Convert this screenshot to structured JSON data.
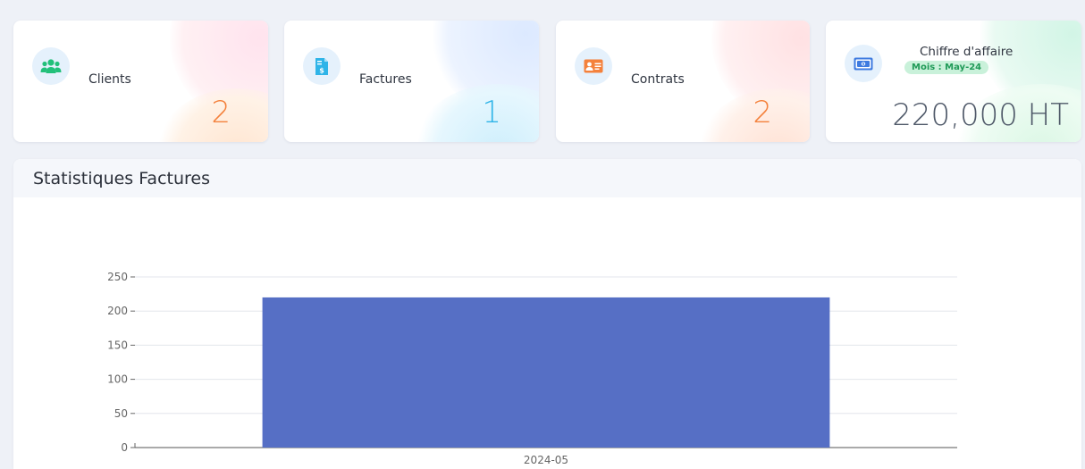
{
  "cards": {
    "clients": {
      "label": "Clients",
      "value": "2",
      "color": "#f4813c",
      "icon": "users-icon",
      "icon_color": "#22c07a"
    },
    "factures": {
      "label": "Factures",
      "value": "1",
      "color": "#2fb4e8",
      "icon": "invoice-dollar-icon",
      "icon_color": "#2fb4e8"
    },
    "contrats": {
      "label": "Contrats",
      "value": "2",
      "color": "#f4813c",
      "icon": "id-card-icon",
      "icon_color": "#f4813c"
    },
    "chiffre": {
      "label": "Chiffre d'affaire",
      "badge": "Mois : May-24",
      "value": "220,000 HT",
      "icon": "money-bill-icon",
      "icon_color": "#3f7be0"
    }
  },
  "panel": {
    "title": "Statistiques Factures"
  },
  "chart_data": {
    "type": "bar",
    "categories": [
      "2024-05"
    ],
    "values": [
      220
    ],
    "ylim": [
      0,
      250
    ],
    "yticks": [
      0,
      50,
      100,
      150,
      200,
      250
    ],
    "grid": true,
    "bar_color": "#566fc5",
    "title": "",
    "xlabel": "",
    "ylabel": ""
  }
}
